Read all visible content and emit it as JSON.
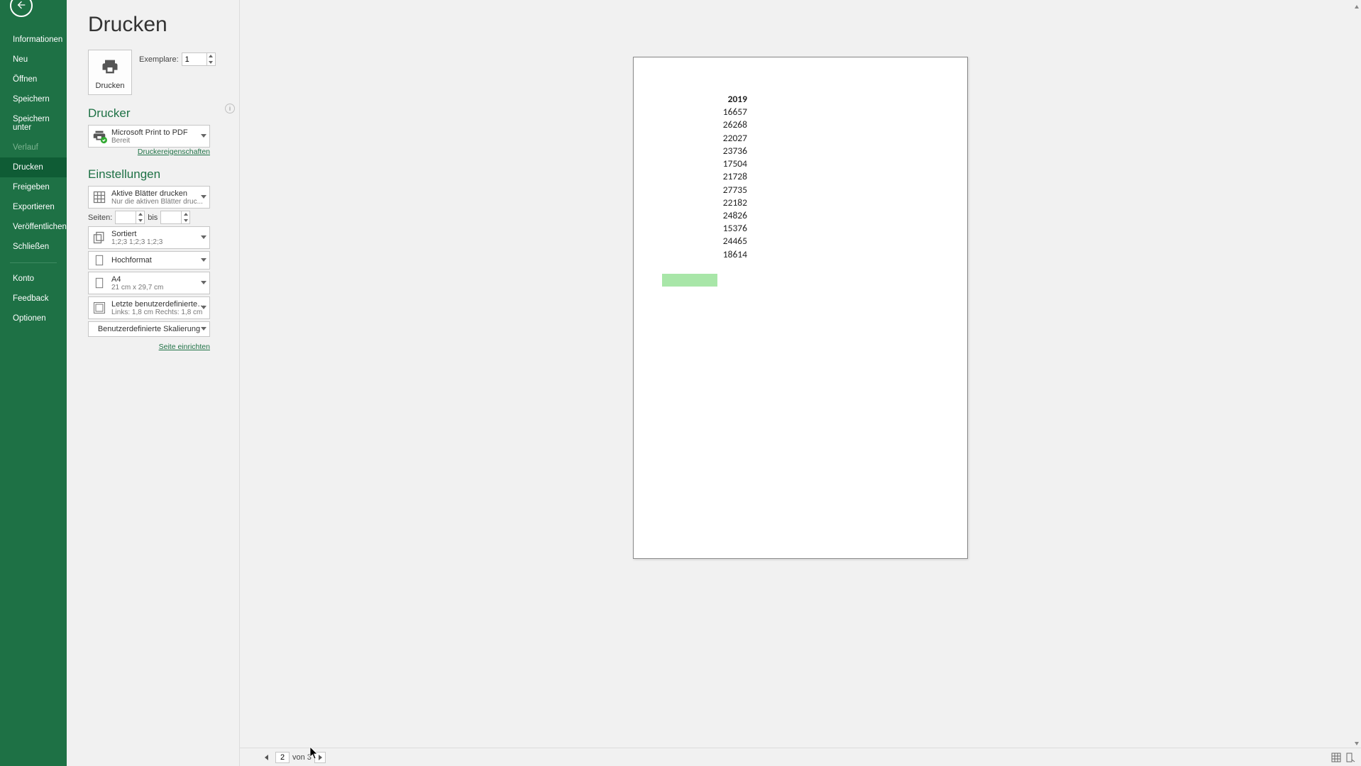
{
  "sidebar": {
    "items": [
      {
        "label": "Informationen"
      },
      {
        "label": "Neu"
      },
      {
        "label": "Öffnen"
      },
      {
        "label": "Speichern"
      },
      {
        "label": "Speichern unter"
      },
      {
        "label": "Verlauf"
      },
      {
        "label": "Drucken"
      },
      {
        "label": "Freigeben"
      },
      {
        "label": "Exportieren"
      },
      {
        "label": "Veröffentlichen"
      },
      {
        "label": "Schließen"
      }
    ],
    "footer_items": [
      {
        "label": "Konto"
      },
      {
        "label": "Feedback"
      },
      {
        "label": "Optionen"
      }
    ]
  },
  "page_title": "Drucken",
  "print_button_label": "Drucken",
  "copies": {
    "label": "Exemplare:",
    "value": "1"
  },
  "printer": {
    "header": "Drucker",
    "name": "Microsoft Print to PDF",
    "status": "Bereit",
    "properties_link": "Druckereigenschaften"
  },
  "settings": {
    "header": "Einstellungen",
    "print_what": {
      "title": "Aktive Blätter drucken",
      "sub": "Nur die aktiven Blätter druc..."
    },
    "pages": {
      "label": "Seiten:",
      "to_label": "bis",
      "from": "",
      "to": ""
    },
    "collation": {
      "title": "Sortiert",
      "sub": "1;2;3    1;2;3    1;2;3"
    },
    "orientation": {
      "title": "Hochformat"
    },
    "paper": {
      "title": "A4",
      "sub": "21 cm x 29,7 cm"
    },
    "margins": {
      "title": "Letzte benutzerdefinierte Sei...",
      "sub": "Links: 1,8 cm    Rechts: 1,8 cm"
    },
    "scaling": {
      "title": "Benutzerdefinierte Skalierung"
    },
    "page_setup_link": "Seite einrichten"
  },
  "footer": {
    "current_page": "2",
    "total_pages_label": "von 3"
  },
  "preview": {
    "header": "2019",
    "values": [
      "16657",
      "26268",
      "22027",
      "23736",
      "17504",
      "21728",
      "27735",
      "22182",
      "24826",
      "15376",
      "24465",
      "18614"
    ]
  }
}
